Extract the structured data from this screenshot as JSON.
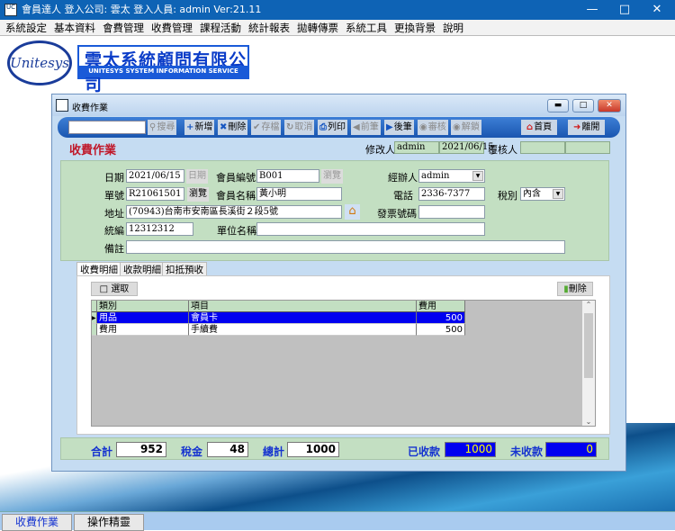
{
  "app": {
    "title": "會員達人  登入公司: 雲太  登入人員: admin Ver:21.11",
    "icon_text": "UC",
    "window_buttons": [
      "minimize",
      "maximize",
      "close"
    ]
  },
  "menu": [
    "系統設定",
    "基本資料",
    "會費管理",
    "收費管理",
    "課程活動",
    "統計報表",
    "拋轉傳票",
    "系統工具",
    "更換背景",
    "說明"
  ],
  "logo": {
    "oval_text": "Unitesys",
    "cn": "雲太系統顧問有限公司",
    "en": "UNITESYS SYSTEM INFORMATION SERVICE CO.,LTD."
  },
  "window": {
    "title": "收費作業",
    "form_title": "收費作業"
  },
  "toolbar": {
    "search_value": "",
    "search": "搜尋",
    "add": "新增",
    "delete": "刪除",
    "save": "存檔",
    "cancel": "取消",
    "print": "列印",
    "prev": "前筆",
    "next": "後筆",
    "audit": "審核",
    "unlock": "解鎖",
    "home": "首頁",
    "exit": "離開"
  },
  "audit": {
    "modifier_label": "修改人",
    "modifier": "admin",
    "modified_date": "2021/06/15",
    "reviewer_label": "覆核人",
    "reviewer": "",
    "review_date": ""
  },
  "form": {
    "date_label": "日期",
    "date": "2021/06/15",
    "date_btn": "日期",
    "member_no_label": "會員編號",
    "member_no": "B001",
    "browse1": "瀏覽",
    "handler_label": "經辦人",
    "handler": "admin",
    "doc_no_label": "單號",
    "doc_no": "R21061501",
    "browse2": "瀏覽",
    "member_name_label": "會員名稱",
    "member_name": "黃小明",
    "phone_label": "電話",
    "phone": "2336-7377",
    "tax_type_label": "稅別",
    "tax_type": "內含",
    "address_label": "地址",
    "address": "(70943)台南市安南區長溪街２段5號",
    "invoice_label": "發票號碼",
    "invoice": "",
    "tax_id_label": "統編",
    "tax_id": "12312312",
    "company_label": "單位名稱",
    "company": "",
    "note_label": "備註",
    "note": ""
  },
  "tabs": [
    "收費明細",
    "收款明細",
    "扣抵預收"
  ],
  "detail": {
    "select_btn": "選取",
    "delete_btn": "刪除",
    "columns": [
      "類別",
      "項目",
      "費用"
    ],
    "rows": [
      {
        "category": "用品",
        "item": "會員卡",
        "fee": "500"
      },
      {
        "category": "費用",
        "item": "手續費",
        "fee": "500"
      }
    ]
  },
  "totals": {
    "subtotal_label": "合計",
    "subtotal": "952",
    "tax_label": "稅金",
    "tax": "48",
    "total_label": "總計",
    "total": "1000",
    "received_label": "已收款",
    "received": "1000",
    "unpaid_label": "未收款",
    "unpaid": "0"
  },
  "taskbar": [
    "收費作業",
    "操作精靈"
  ],
  "colors": {
    "titlebar": "#0e63b5",
    "form_green": "#c3dfc2",
    "selected_row": "#0000f0",
    "label_blue": "#1533d0",
    "form_title_red": "#c0182a"
  }
}
